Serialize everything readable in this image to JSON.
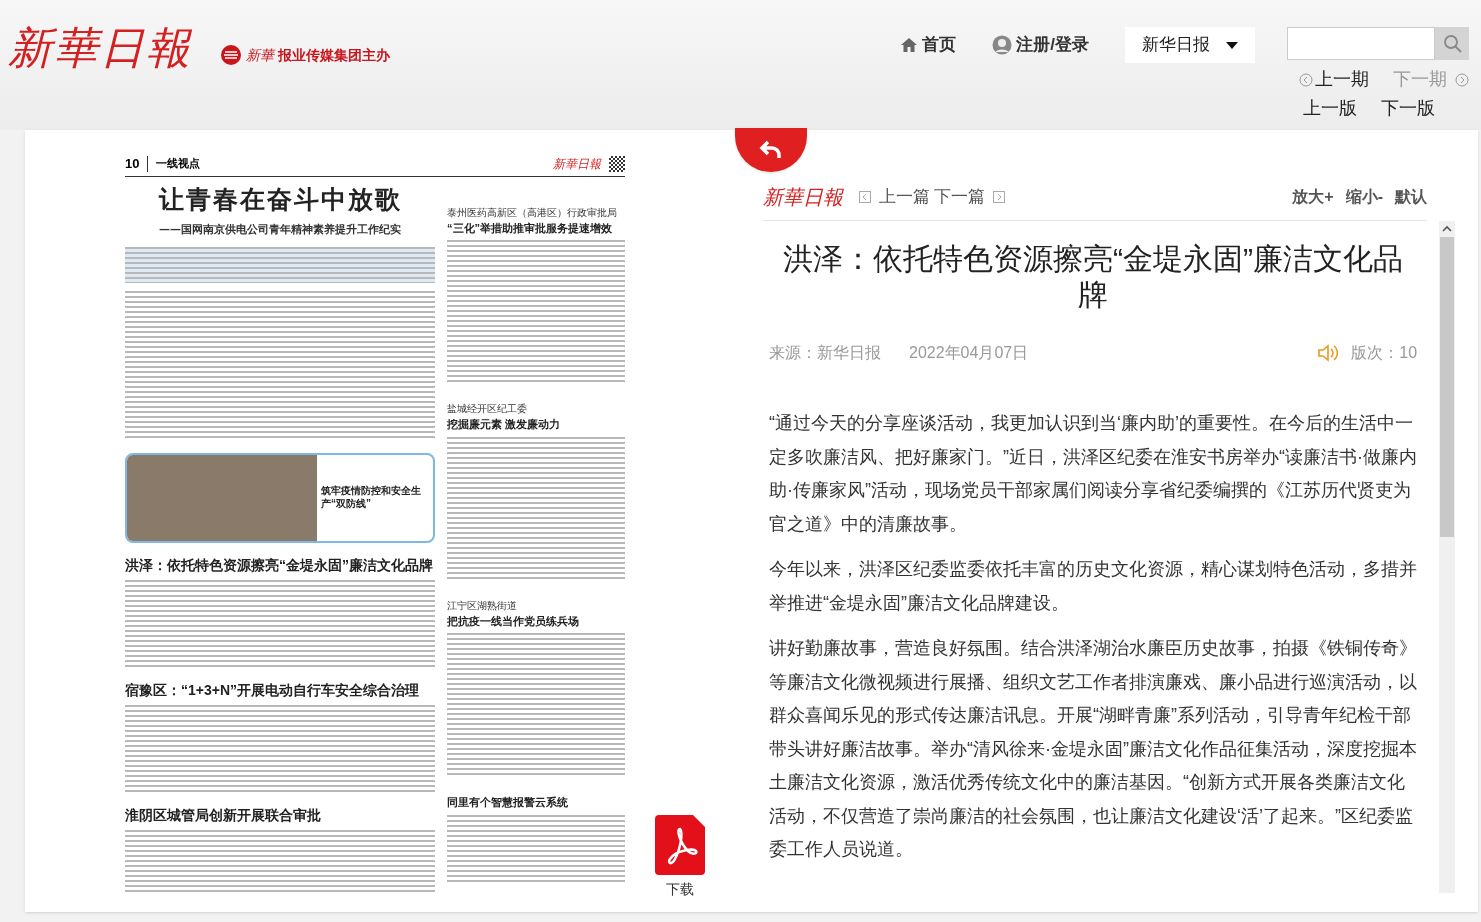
{
  "header": {
    "logo": "新華日報",
    "sponsor_brand": "新華",
    "sponsor": "报业传媒集团主办",
    "nav": [
      {
        "kind": "home",
        "label": "首页"
      },
      {
        "kind": "user",
        "label": "注册/登录"
      }
    ],
    "paper_select": "新华日报",
    "issue_prev": "上一期",
    "issue_next": "下一期",
    "page_prev": "上一版",
    "page_next": "下一版"
  },
  "newspaper_page": {
    "page_number": "10",
    "section": "一线视点",
    "masthead": "新華日報",
    "left_articles": [
      {
        "kind": "lead",
        "title": "让青春在奋斗中放歌",
        "subtitle": "——国网南京供电公司青年精神素养提升工作纪实"
      },
      {
        "kind": "photo",
        "title": "筑牢疫情防控和安全生产“双防线”"
      },
      {
        "kind": "story",
        "title": "洪泽：依托特色资源擦亮“金堤永固”廉洁文化品牌"
      },
      {
        "kind": "story",
        "title": "宿豫区：“1+3+N”开展电动自行车安全综合治理"
      },
      {
        "kind": "story",
        "title": "淮阴区城管局创新开展联合审批"
      }
    ],
    "right_articles": [
      {
        "kicker": "泰州医药高新区（高港区）行政审批局",
        "title": "“三化”举措助推审批服务提速增效"
      },
      {
        "kicker": "盐城经开区纪工委",
        "title": "挖掘廉元素 激发廉动力"
      },
      {
        "kicker": "江宁区湖熟街道",
        "title": "把抗疫一线当作党员练兵场"
      },
      {
        "title": "同里有个智慧报警云系统"
      }
    ]
  },
  "download": {
    "label": "下载"
  },
  "article": {
    "logo": "新華日報",
    "prev": "上一篇",
    "next": "下一篇",
    "font_controls": [
      "放大+",
      "缩小-",
      "默认"
    ],
    "title": "洪泽：依托特色资源擦亮“金堤永固”廉洁文化品牌",
    "source": "来源：新华日报",
    "date": "2022年04月07日",
    "edition": "版次：10",
    "paragraphs": [
      "“通过今天的分享座谈活动，我更加认识到当‘廉内助’的重要性。在今后的生活中一定多吹廉洁风、把好廉家门。”近日，洪泽区纪委在淮安书房举办“读廉洁书·做廉内助·传廉家风”活动，现场党员干部家属们阅读分享省纪委编撰的《江苏历代贤吏为官之道》中的清廉故事。",
      "今年以来，洪泽区纪委监委依托丰富的历史文化资源，精心谋划特色活动，多措并举推进“金堤永固”廉洁文化品牌建设。",
      "讲好勤廉故事，营造良好氛围。结合洪泽湖治水廉臣历史故事，拍摄《铁铜传奇》等廉洁文化微视频进行展播、组织文艺工作者排演廉戏、廉小品进行巡演活动，以群众喜闻乐见的形式传达廉洁讯息。开展“湖畔青廉”系列活动，引导青年纪检干部带头讲好廉洁故事。举办“清风徐来·金堤永固”廉洁文化作品征集活动，深度挖掘本土廉洁文化资源，激活优秀传统文化中的廉洁基因。“创新方式开展各类廉洁文化活动，不仅营造了崇尚廉洁的社会氛围，也让廉洁文化建设‘活’了起来。”区纪委监委工作人员说道。"
    ]
  }
}
